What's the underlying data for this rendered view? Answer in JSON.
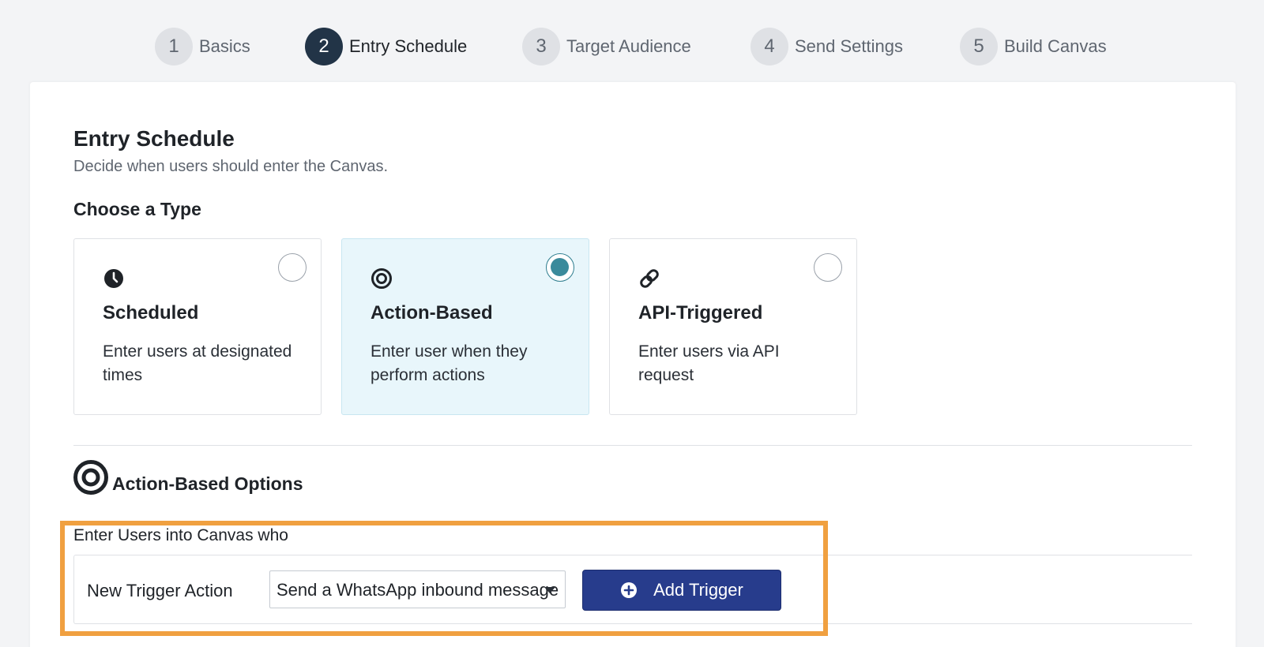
{
  "stepper": {
    "steps": [
      {
        "num": "1",
        "label": "Basics"
      },
      {
        "num": "2",
        "label": "Entry Schedule"
      },
      {
        "num": "3",
        "label": "Target Audience"
      },
      {
        "num": "4",
        "label": "Send Settings"
      },
      {
        "num": "5",
        "label": "Build Canvas"
      }
    ],
    "active_step": 2
  },
  "page": {
    "title": "Entry Schedule",
    "subtitle": "Decide when users should enter the Canvas.",
    "choose_label": "Choose a Type"
  },
  "types": [
    {
      "icon": "clock-icon",
      "title": "Scheduled",
      "desc": "Enter users at designated times",
      "selected": false
    },
    {
      "icon": "target-icon",
      "title": "Action-Based",
      "desc": "Enter user when they perform actions",
      "selected": true
    },
    {
      "icon": "link-icon",
      "title": "API-Triggered",
      "desc": "Enter users via API request",
      "selected": false
    }
  ],
  "options": {
    "title": "Action-Based Options",
    "icon": "target-icon",
    "enter_label": "Enter Users into Canvas who",
    "trigger_label": "New Trigger Action",
    "trigger_select_value": "Send a WhatsApp inbound message",
    "add_button_label": "Add Trigger",
    "add_button_icon": "plus-circle-icon"
  },
  "colors": {
    "active_step": "#223447",
    "selected_card": "#e8f6fb",
    "radio_selected": "#3a8a9b",
    "primary_button": "#273c8c",
    "highlight_border": "#f0a040"
  }
}
